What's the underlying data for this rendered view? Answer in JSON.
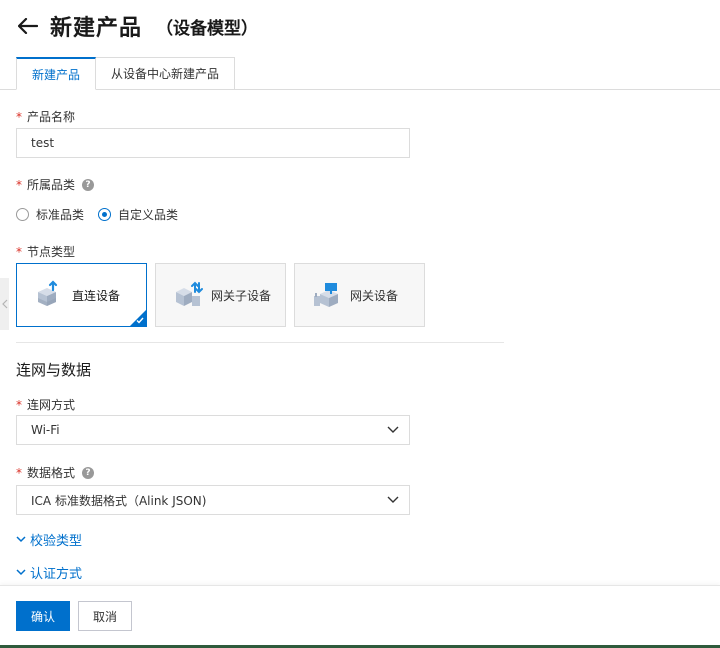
{
  "header": {
    "title": "新建产品",
    "subtitle": "（设备模型）",
    "back_icon": "arrow-left-icon"
  },
  "tabs": [
    {
      "label": "新建产品",
      "active": true
    },
    {
      "label": "从设备中心新建产品",
      "active": false
    }
  ],
  "form": {
    "product_name": {
      "label": "产品名称",
      "value": "test",
      "required": true
    },
    "category": {
      "label": "所属品类",
      "required": true,
      "help_icon": "question-circle-icon",
      "options": [
        {
          "label": "标准品类",
          "checked": false
        },
        {
          "label": "自定义品类",
          "checked": true
        }
      ]
    },
    "node_type": {
      "label": "节点类型",
      "required": true,
      "options": [
        {
          "label": "直连设备",
          "selected": true,
          "icon": "direct-device-icon"
        },
        {
          "label": "网关子设备",
          "selected": false,
          "icon": "gateway-subdevice-icon"
        },
        {
          "label": "网关设备",
          "selected": false,
          "icon": "gateway-device-icon"
        }
      ]
    },
    "section_title": "连网与数据",
    "network": {
      "label": "连网方式",
      "required": true,
      "value": "Wi-Fi"
    },
    "data_format": {
      "label": "数据格式",
      "required": true,
      "help_icon": "question-circle-icon",
      "value": "ICA 标准数据格式（Alink JSON)"
    },
    "collapse_links": [
      {
        "label": "校验类型"
      },
      {
        "label": "认证方式"
      }
    ]
  },
  "footer": {
    "confirm_label": "确认",
    "cancel_label": "取消"
  },
  "colors": {
    "accent": "#0070cc",
    "required": "#d93026",
    "border": "#dcdcdc"
  }
}
